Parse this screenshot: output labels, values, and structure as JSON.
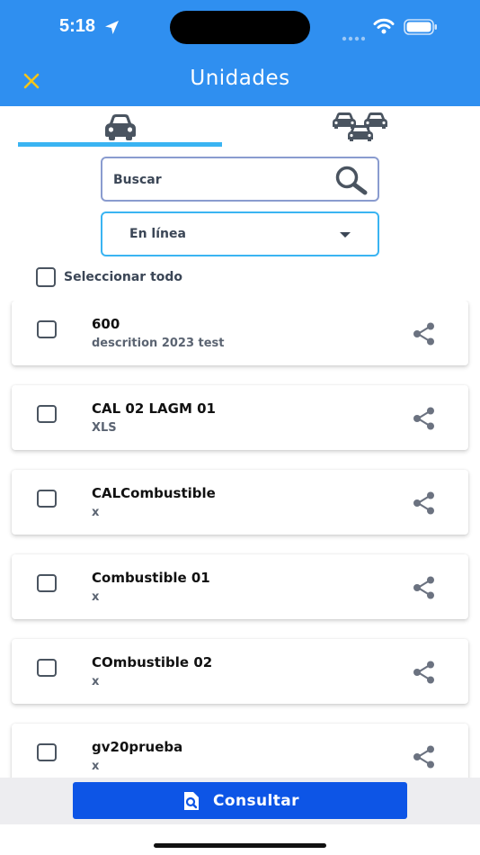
{
  "status_bar": {
    "time": "5:18"
  },
  "header": {
    "title": "Unidades"
  },
  "search": {
    "placeholder": "Buscar"
  },
  "filter": {
    "selected": "En línea"
  },
  "select_all": {
    "label": "Seleccionar todo"
  },
  "units": [
    {
      "title": "600",
      "subtitle": "descrition 2023 test"
    },
    {
      "title": "CAL 02 LAGM 01",
      "subtitle": "XLS"
    },
    {
      "title": "CALCombustible",
      "subtitle": "x"
    },
    {
      "title": "Combustible 01",
      "subtitle": "x"
    },
    {
      "title": "COmbustible 02",
      "subtitle": "x"
    },
    {
      "title": "gv20prueba",
      "subtitle": "x"
    }
  ],
  "footer": {
    "consult_label": "Consultar"
  },
  "colors": {
    "header": "#2f8ff0",
    "accent": "#3ab4f2",
    "close_icon": "#f5c518",
    "button": "#0d55e6"
  },
  "icons": [
    "location-arrow-icon",
    "wifi-icon",
    "battery-icon",
    "close-icon",
    "car-icon",
    "cars-group-icon",
    "search-icon",
    "caret-down-icon",
    "share-icon",
    "consult-icon"
  ]
}
